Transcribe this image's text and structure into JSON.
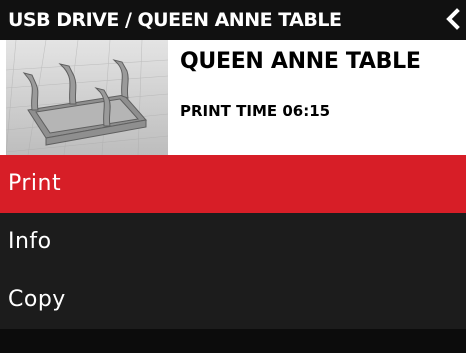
{
  "header": {
    "breadcrumb": "USB DRIVE / QUEEN ANNE TABLE",
    "back_icon": "chevron-left-icon"
  },
  "file": {
    "name": "QUEEN ANNE TABLE",
    "print_time": "PRINT TIME 06:15"
  },
  "menu": {
    "items": [
      {
        "label": "Print",
        "active": true
      },
      {
        "label": "Info",
        "active": false
      },
      {
        "label": "Copy",
        "active": false
      }
    ]
  },
  "colors": {
    "header_bg": "#111111",
    "accent_red": "#d71e27",
    "menu_bg": "#1c1c1c",
    "text_light": "#ffffff"
  }
}
